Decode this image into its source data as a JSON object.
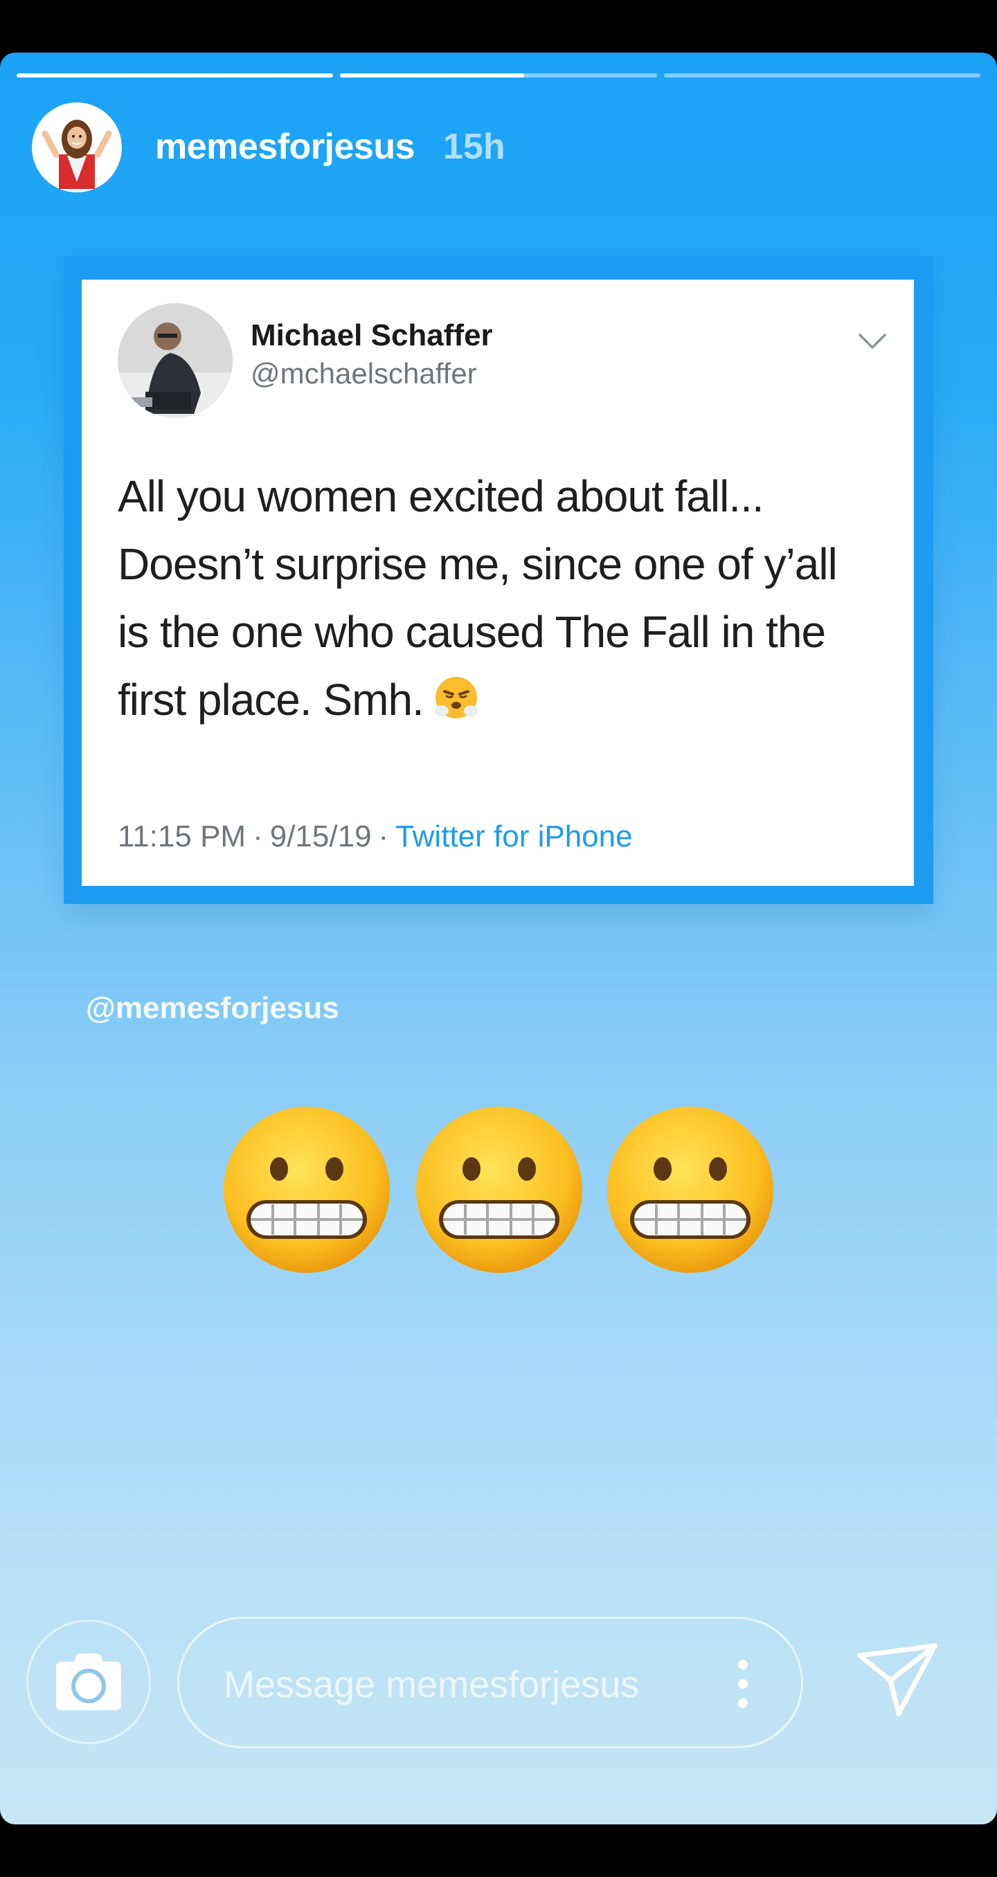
{
  "story": {
    "progress": [
      1.0,
      0.58,
      0.0
    ],
    "username": "memesforjesus",
    "time_ago": "15h",
    "avatar_icon": "jesus-avatar-icon"
  },
  "tweet": {
    "name": "Michael Schaffer",
    "handle": "@mchaelschaffer",
    "body_lines": [
      "All you women excited about fall...",
      "Doesn’t surprise me, since one of y’all",
      "is the one who caused The Fall in the",
      "first place. Smh."
    ],
    "emoji": "😤",
    "time": "11:15 PM",
    "date": "9/15/19",
    "separator": "·",
    "source": "Twitter for iPhone"
  },
  "watermark": "@memesforjesus",
  "reaction_emoji": "grimacing-face",
  "footer": {
    "message_placeholder": "Message memesforjesus",
    "camera_icon": "camera-icon",
    "send_icon": "send-icon",
    "more_icon": "more-vertical-icon"
  },
  "colors": {
    "accent": "#1d9bf0",
    "story_top": "#1aa2f5",
    "story_bottom": "#c8e6f6"
  }
}
